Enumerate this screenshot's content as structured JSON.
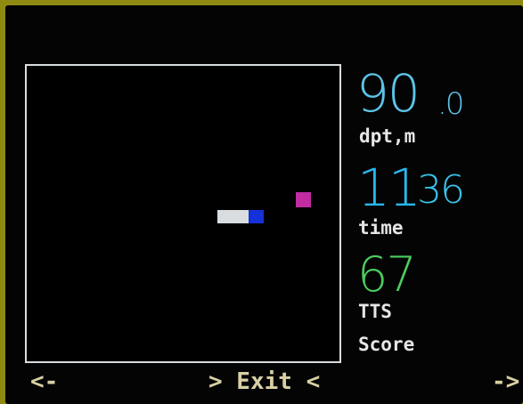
{
  "hud": {
    "depth": {
      "integer": "90",
      "decimal": ".0",
      "label": "dpt,m"
    },
    "time": {
      "minutes": "11",
      "seconds": "36",
      "label": "time"
    },
    "tts": {
      "value": "67",
      "label": "TTS"
    },
    "score_label": "Score"
  },
  "softkeys": {
    "left": "<-",
    "center": "> Exit <",
    "right": "->"
  },
  "colors": {
    "background": "#040404",
    "bezel": "#8f8a12",
    "field_border": "#d8dde0",
    "depth": "#5cc4e8",
    "time": "#28b8f0",
    "tts": "#4ccc5e",
    "player_body": "#d9dde0",
    "player_head": "#1432d8",
    "target": "#c12ca2",
    "label_text": "#e6e6e6",
    "softkey_text": "#d8d0a4"
  }
}
